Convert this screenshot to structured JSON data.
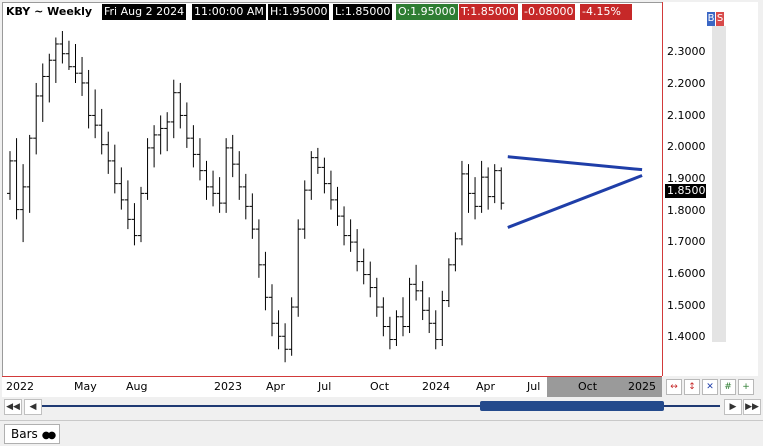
{
  "header": {
    "symbol_period": "KBY ~ Weekly",
    "date": "Fri Aug 2 2024",
    "time": "11:00:00 AM",
    "high": "H:1.95000",
    "low": "L:1.85000",
    "open": "O:1.95000",
    "close": "T:1.85000",
    "change": "-0.08000",
    "change_pct": "-4.15%"
  },
  "colors": {
    "up": "#2e7d32",
    "down": "#c62828",
    "trendline": "#1f3ea8",
    "scrollbar": "#244a8c"
  },
  "y_ticks": [
    "2.3000",
    "2.2000",
    "2.1000",
    "2.0000",
    "1.9000",
    "1.8000",
    "1.7000",
    "1.6000",
    "1.5000",
    "1.4000"
  ],
  "last_price": "1.8500",
  "x_ticks": [
    "2022",
    "May",
    "Aug",
    "2023",
    "Apr",
    "Jul",
    "Oct",
    "2024",
    "Apr",
    "Jul",
    "Oct",
    "2025"
  ],
  "right_panel": {
    "b_label": "B",
    "s_label": "S"
  },
  "toolbar_icons": [
    "zoom-h-icon",
    "zoom-v-icon",
    "zoom-all-icon",
    "grid-icon",
    "crosshair-icon"
  ],
  "scroll": {
    "left_icon": "◀◀",
    "prev_icon": "◀",
    "next_icon": "▶",
    "right_icon": "▶▶"
  },
  "bottom": {
    "tab_label": "Bars",
    "tab_icon": "●●"
  },
  "chart_data": {
    "type": "bar",
    "style": "ohlc",
    "period": "weekly",
    "ylim": [
      1.33,
      2.42
    ],
    "y_ticks": [
      1.4,
      1.5,
      1.6,
      1.7,
      1.8,
      1.9,
      2.0,
      2.1,
      2.2,
      2.3
    ],
    "bars": [
      [
        1.88,
        2.01,
        1.86,
        1.98
      ],
      [
        1.98,
        2.05,
        1.8,
        1.83
      ],
      [
        1.83,
        1.97,
        1.73,
        1.9
      ],
      [
        1.9,
        2.06,
        1.82,
        2.05
      ],
      [
        2.05,
        2.22,
        2.0,
        2.18
      ],
      [
        2.18,
        2.28,
        2.1,
        2.24
      ],
      [
        2.24,
        2.31,
        2.16,
        2.29
      ],
      [
        2.29,
        2.36,
        2.22,
        2.34
      ],
      [
        2.34,
        2.38,
        2.28,
        2.31
      ],
      [
        2.31,
        2.35,
        2.26,
        2.27
      ],
      [
        2.27,
        2.34,
        2.22,
        2.25
      ],
      [
        2.25,
        2.3,
        2.18,
        2.22
      ],
      [
        2.22,
        2.26,
        2.08,
        2.12
      ],
      [
        2.12,
        2.2,
        2.05,
        2.09
      ],
      [
        2.09,
        2.14,
        2.0,
        2.03
      ],
      [
        2.03,
        2.07,
        1.94,
        1.98
      ],
      [
        1.98,
        2.03,
        1.88,
        1.91
      ],
      [
        1.91,
        1.96,
        1.83,
        1.86
      ],
      [
        1.86,
        1.92,
        1.77,
        1.8
      ],
      [
        1.8,
        1.85,
        1.72,
        1.75
      ],
      [
        1.75,
        1.9,
        1.73,
        1.88
      ],
      [
        1.88,
        2.05,
        1.86,
        2.02
      ],
      [
        2.02,
        2.09,
        1.96,
        2.06
      ],
      [
        2.06,
        2.12,
        2.0,
        2.08
      ],
      [
        2.08,
        2.13,
        2.01,
        2.1
      ],
      [
        2.1,
        2.23,
        2.05,
        2.19
      ],
      [
        2.19,
        2.22,
        2.08,
        2.12
      ],
      [
        2.12,
        2.16,
        2.02,
        2.05
      ],
      [
        2.05,
        2.09,
        1.96,
        2.0
      ],
      [
        2.0,
        2.05,
        1.92,
        1.95
      ],
      [
        1.95,
        1.98,
        1.86,
        1.9
      ],
      [
        1.9,
        1.95,
        1.84,
        1.88
      ],
      [
        1.88,
        1.93,
        1.82,
        1.85
      ],
      [
        1.85,
        2.05,
        1.82,
        2.02
      ],
      [
        2.02,
        2.06,
        1.93,
        1.97
      ],
      [
        1.97,
        2.01,
        1.86,
        1.9
      ],
      [
        1.9,
        1.94,
        1.8,
        1.84
      ],
      [
        1.84,
        1.88,
        1.74,
        1.77
      ],
      [
        1.77,
        1.8,
        1.62,
        1.66
      ],
      [
        1.66,
        1.7,
        1.52,
        1.56
      ],
      [
        1.56,
        1.6,
        1.44,
        1.48
      ],
      [
        1.48,
        1.52,
        1.4,
        1.44
      ],
      [
        1.44,
        1.48,
        1.36,
        1.4
      ],
      [
        1.4,
        1.56,
        1.38,
        1.53
      ],
      [
        1.53,
        1.8,
        1.5,
        1.77
      ],
      [
        1.77,
        1.92,
        1.74,
        1.89
      ],
      [
        1.89,
        2.01,
        1.86,
        1.99
      ],
      [
        1.99,
        2.02,
        1.94,
        1.96
      ],
      [
        1.96,
        1.99,
        1.88,
        1.91
      ],
      [
        1.91,
        1.95,
        1.83,
        1.86
      ],
      [
        1.86,
        1.9,
        1.78,
        1.81
      ],
      [
        1.81,
        1.84,
        1.72,
        1.75
      ],
      [
        1.75,
        1.8,
        1.7,
        1.73
      ],
      [
        1.73,
        1.77,
        1.64,
        1.67
      ],
      [
        1.67,
        1.71,
        1.6,
        1.63
      ],
      [
        1.63,
        1.67,
        1.56,
        1.59
      ],
      [
        1.59,
        1.62,
        1.5,
        1.53
      ],
      [
        1.53,
        1.56,
        1.44,
        1.47
      ],
      [
        1.47,
        1.5,
        1.4,
        1.43
      ],
      [
        1.43,
        1.52,
        1.41,
        1.5
      ],
      [
        1.5,
        1.56,
        1.44,
        1.47
      ],
      [
        1.47,
        1.62,
        1.45,
        1.6
      ],
      [
        1.6,
        1.66,
        1.55,
        1.58
      ],
      [
        1.58,
        1.61,
        1.49,
        1.52
      ],
      [
        1.52,
        1.56,
        1.45,
        1.48
      ],
      [
        1.48,
        1.52,
        1.4,
        1.43
      ],
      [
        1.43,
        1.58,
        1.41,
        1.55
      ],
      [
        1.55,
        1.68,
        1.53,
        1.66
      ],
      [
        1.66,
        1.76,
        1.64,
        1.74
      ],
      [
        1.74,
        1.98,
        1.72,
        1.94
      ],
      [
        1.94,
        1.97,
        1.82,
        1.88
      ],
      [
        1.88,
        1.93,
        1.8,
        1.84
      ],
      [
        1.84,
        1.98,
        1.82,
        1.93
      ],
      [
        1.93,
        1.96,
        1.83,
        1.87
      ],
      [
        1.87,
        1.97,
        1.85,
        1.95
      ],
      [
        1.95,
        1.96,
        1.83,
        1.85
      ]
    ],
    "trendlines": [
      {
        "name": "upper",
        "from": [
          76.0,
          1.993
        ],
        "to": [
          96.5,
          1.953
        ]
      },
      {
        "name": "lower",
        "from": [
          76.0,
          1.775
        ],
        "to": [
          96.5,
          1.935
        ]
      }
    ],
    "x_ticks": [
      "2022",
      "May",
      "Aug",
      "2023",
      "Apr",
      "Jul",
      "Oct",
      "2024",
      "Apr",
      "Jul",
      "Oct",
      "2025"
    ]
  }
}
